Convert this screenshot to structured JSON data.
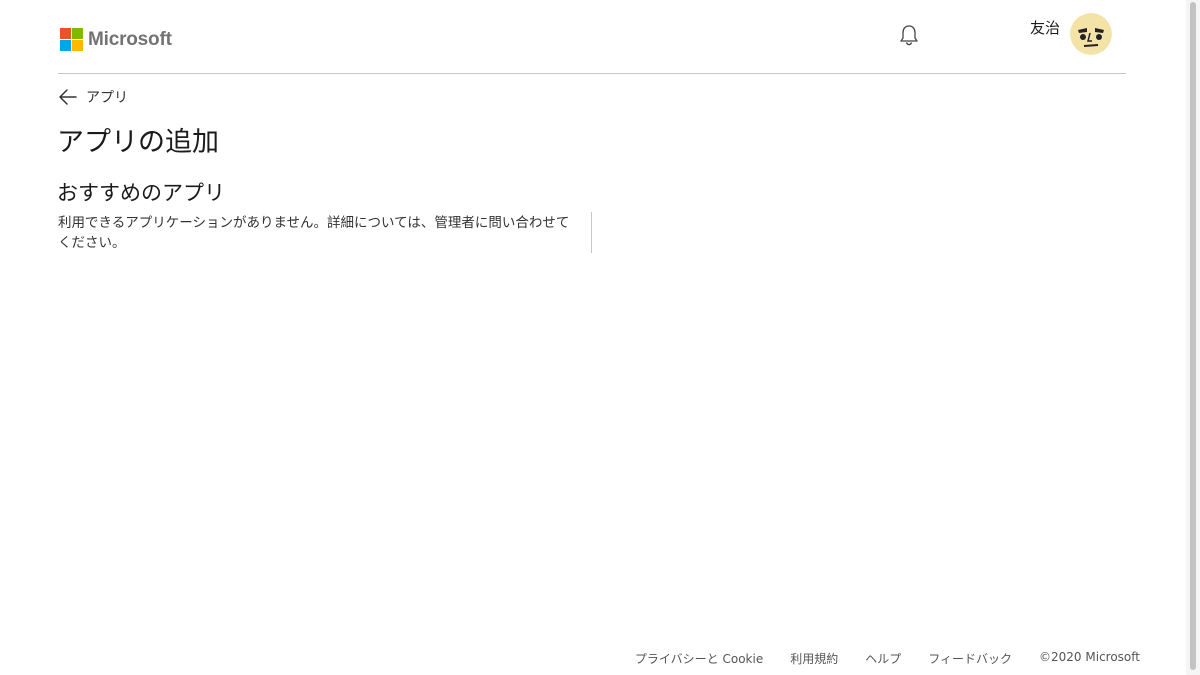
{
  "header": {
    "brand": "Microsoft",
    "logo_colors": [
      "#f25022",
      "#7fba00",
      "#00a4ef",
      "#ffb900"
    ],
    "bell_icon": "bell-icon",
    "user_name": "友治"
  },
  "nav": {
    "back_icon": "arrow-left-icon",
    "back_label": "アプリ"
  },
  "main": {
    "title": "アプリの追加",
    "section_title": "おすすめのアプリ",
    "section_message": "利用できるアプリケーションがありません。詳細については、管理者に問い合わせてください。"
  },
  "footer": {
    "privacy": "プライバシーと Cookie",
    "terms": "利用規約",
    "help": "ヘルプ",
    "feedback": "フィードバック",
    "copyright": "©2020 Microsoft"
  }
}
